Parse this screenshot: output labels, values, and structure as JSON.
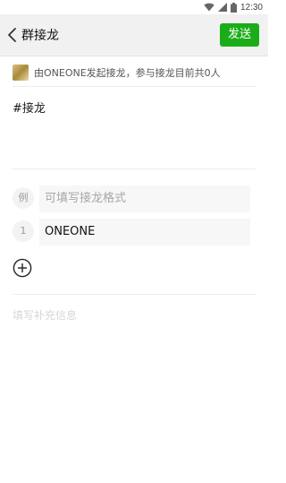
{
  "status_bar": {
    "time": "12:30",
    "icons": [
      "wifi-icon",
      "signal-icon",
      "battery-icon"
    ]
  },
  "header": {
    "back_icon": "chevron-left-icon",
    "title": "群接龙",
    "send_label": "发送",
    "accent_color": "#1aad19"
  },
  "creator": {
    "notice": "由ONEONE发起接龙，参与接龙目前共0人"
  },
  "topic": "#接龙",
  "entries": [
    {
      "badge": "例",
      "value": "",
      "placeholder": "可填写接龙格式"
    },
    {
      "badge": "1",
      "value": "ONEONE",
      "placeholder": ""
    }
  ],
  "add_icon": "plus-circle-icon",
  "supplement_placeholder": "填写补充信息"
}
